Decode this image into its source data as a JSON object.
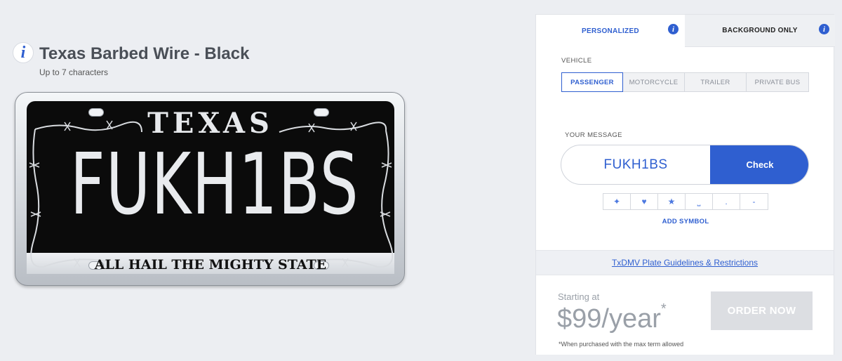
{
  "plate": {
    "title": "Texas Barbed Wire - Black",
    "subtitle": "Up to 7 characters",
    "state_name": "TEXAS",
    "message": "FUKH1BS",
    "slogan": "ALL HAIL THE MIGHTY STATE",
    "colors": {
      "background": "#0b0b0b",
      "text": "#e9ebee"
    }
  },
  "tabs": [
    {
      "label": "PERSONALIZED",
      "active": true
    },
    {
      "label": "BACKGROUND ONLY",
      "active": false
    }
  ],
  "vehicle": {
    "label": "VEHICLE",
    "options": [
      "PASSENGER",
      "MOTORCYCLE",
      "TRAILER",
      "PRIVATE BUS"
    ],
    "selected": "PASSENGER"
  },
  "message_box": {
    "label": "YOUR MESSAGE",
    "value": "FUKH1BS",
    "check_label": "Check"
  },
  "symbols": {
    "items": [
      {
        "icon": "texas-icon",
        "glyph": "✦"
      },
      {
        "icon": "heart-icon",
        "glyph": "♥"
      },
      {
        "icon": "star-icon",
        "glyph": "★"
      },
      {
        "icon": "space-icon",
        "glyph": "⎵"
      },
      {
        "icon": "period-icon",
        "glyph": "."
      },
      {
        "icon": "dash-icon",
        "glyph": "-"
      }
    ],
    "add_label": "ADD SYMBOL"
  },
  "guidelines_link": "TxDMV Plate Guidelines & Restrictions",
  "pricing": {
    "starting_label": "Starting at",
    "price": "$99/year",
    "asterisk": "*",
    "footnote": "*When purchased with the max term allowed",
    "order_label": "ORDER NOW"
  },
  "colors": {
    "accent": "#2f5fd0",
    "page_bg": "#eceef2",
    "disabled": "#dcdee2"
  }
}
